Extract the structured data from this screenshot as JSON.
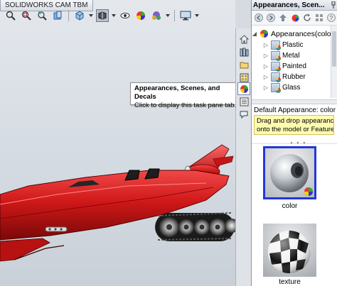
{
  "viewport": {
    "cam_tab_label": "SOLIDWORKS CAM TBM",
    "toolbar_icons": [
      "zoom-to-fit-icon",
      "zoom-area-icon",
      "previous-view-icon",
      "section-view-icon",
      "view-orientation-icon",
      "display-style-icon",
      "hide-show-items-icon",
      "edit-appearance-icon",
      "apply-scene-icon",
      "view-settings-icon"
    ]
  },
  "tooltip": {
    "title": "Appearances, Scenes, and Decals",
    "body": "Click to display this task pane tab."
  },
  "tab_strip": {
    "tabs": [
      "solidworks-resources-icon",
      "design-library-icon",
      "file-explorer-icon",
      "view-palette-icon",
      "appearances-scenes-decals-icon",
      "custom-properties-icon",
      "forum-icon"
    ],
    "active_tab": "appearances-scenes-decals-icon"
  },
  "pane": {
    "title": "Appearances, Scen...",
    "tree": {
      "root": "Appearances(color)",
      "children": [
        "Plastic",
        "Metal",
        "Painted",
        "Rubber",
        "Glass"
      ]
    },
    "default_appearance_label": "Default Appearance: color",
    "hint_line1": "Drag and drop appearances",
    "hint_line2": "onto the model or FeatureM...",
    "swatches": [
      {
        "caption": "color",
        "selected": true
      },
      {
        "caption": "texture",
        "selected": false
      }
    ]
  },
  "colors": {
    "model_red": "#d01818",
    "selection_blue": "#2436d8",
    "hint_yellow": "#fefcb0"
  }
}
